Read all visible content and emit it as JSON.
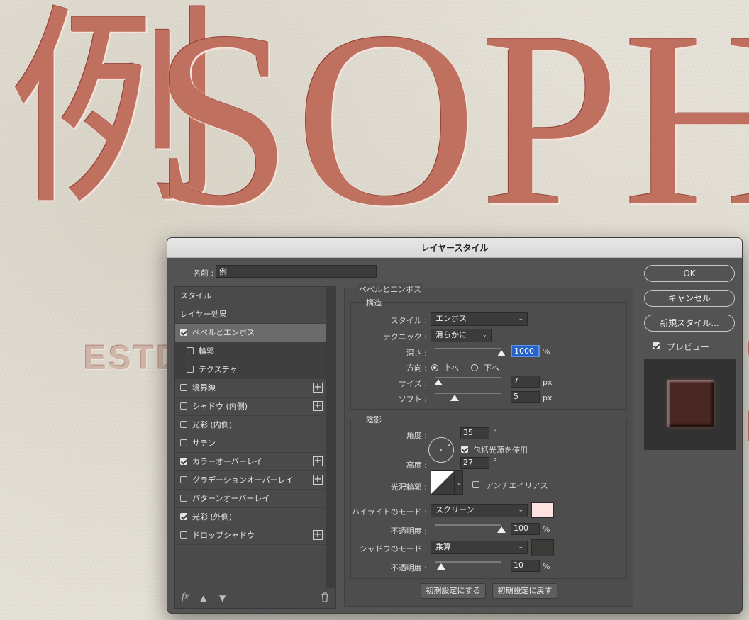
{
  "canvas": {
    "kanji": "例",
    "letters": "SOPHIS",
    "estd": "ESTD",
    "partial_right": "S"
  },
  "dialog": {
    "title": "レイヤースタイル",
    "name_label": "名前 :",
    "name_value": "例",
    "list": {
      "styles": "スタイル",
      "layer_effects": "レイヤー効果",
      "bevel_emboss": "ベベルとエンボス",
      "contour": "輪郭",
      "texture": "テクスチャ",
      "stroke": "境界線",
      "inner_shadow": "シャドウ (内側)",
      "inner_glow": "光彩 (内側)",
      "satin": "サテン",
      "color_overlay": "カラーオーバーレイ",
      "gradient_overlay": "グラデーションオーバーレイ",
      "pattern_overlay": "パターンオーバーレイ",
      "outer_glow": "光彩 (外側)",
      "drop_shadow": "ドロップシャドウ"
    },
    "bevel": {
      "section_title": "ベベルとエンボス",
      "structure_title": "構造",
      "style_label": "スタイル :",
      "style_value": "エンボス",
      "technique_label": "テクニック :",
      "technique_value": "滑らかに",
      "depth_label": "深さ :",
      "depth_value": "1000",
      "depth_unit": "%",
      "direction_label": "方向 :",
      "direction_up": "上へ",
      "direction_down": "下へ",
      "size_label": "サイズ :",
      "size_value": "7",
      "size_unit": "px",
      "soften_label": "ソフト :",
      "soften_value": "5",
      "soften_unit": "px",
      "shading_title": "陰影",
      "angle_label": "角度 :",
      "angle_value": "35",
      "angle_unit": "°",
      "global_light": "包括光源を使用",
      "altitude_label": "高度 :",
      "altitude_value": "27",
      "altitude_unit": "°",
      "gloss_label": "光沢輪郭 :",
      "anti_alias": "アンチエイリアス",
      "highlight_label": "ハイライトのモード :",
      "highlight_mode": "スクリーン",
      "highlight_opacity_label": "不透明度 :",
      "highlight_opacity": "100",
      "highlight_opacity_unit": "%",
      "shadow_label": "シャドウのモード :",
      "shadow_mode": "乗算",
      "shadow_opacity_label": "不透明度 :",
      "shadow_opacity": "10",
      "shadow_opacity_unit": "%",
      "make_default": "初期設定にする",
      "reset_default": "初期設定に戻す",
      "depth_level": 1.0,
      "size_level": 0.05,
      "soften_level": 0.3,
      "highlight_opacity_level": 1.0,
      "shadow_opacity_level": 0.1
    },
    "buttons": {
      "ok": "OK",
      "cancel": "キャンセル",
      "new_style": "新規スタイル...",
      "preview": "プレビュー"
    },
    "colors": {
      "highlight": "#fde2e2",
      "shadow": "#3b3a37",
      "accent": "#2762c9"
    },
    "footer_icons": [
      "fx-icon",
      "arrow-up-icon",
      "arrow-down-icon",
      "trash-icon"
    ]
  }
}
